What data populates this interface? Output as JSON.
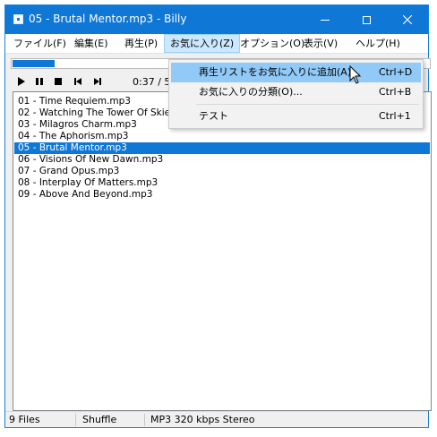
{
  "window": {
    "title": "05 - Brutal Mentor.mp3 - Billy"
  },
  "menubar": {
    "items": [
      {
        "label": "ファイル(F)"
      },
      {
        "label": "編集(E)"
      },
      {
        "label": "再生(P)"
      },
      {
        "label": "お気に入り(Z)",
        "active": true
      },
      {
        "label": "オプション(O)"
      },
      {
        "label": "表示(V)"
      },
      {
        "label": "ヘルプ(H)"
      }
    ]
  },
  "favorites_menu": {
    "items": [
      {
        "label": "再生リストをお気に入りに追加(A)...",
        "shortcut": "Ctrl+D",
        "highlighted": true
      },
      {
        "label": "お気に入りの分類(O)...",
        "shortcut": "Ctrl+B"
      },
      {
        "label": "テスト",
        "shortcut": "Ctrl+1"
      }
    ]
  },
  "player": {
    "progress_percent": 10,
    "time_display": "0:37 / 5",
    "controls": [
      "play-icon",
      "pause-icon",
      "stop-icon",
      "previous-track-icon",
      "next-track-icon"
    ]
  },
  "playlist": {
    "items": [
      "01 - Time Requiem.mp3",
      "02 - Watching The Tower Of Skies",
      "03 - Milagros Charm.mp3",
      "04 - The Aphorism.mp3",
      "05 - Brutal Mentor.mp3",
      "06 - Visions Of New Dawn.mp3",
      "07 - Grand Opus.mp3",
      "08 - Interplay Of Matters.mp3",
      "09 - Above And Beyond.mp3"
    ],
    "selected_index": 4
  },
  "statusbar": {
    "file_count": "9 Files",
    "mode": "Shuffle",
    "format": "MP3 320 kbps Stereo"
  },
  "colors": {
    "accent": "#0f77d6",
    "menu_highlight": "#91c9f7",
    "selection": "#0f77d6"
  }
}
